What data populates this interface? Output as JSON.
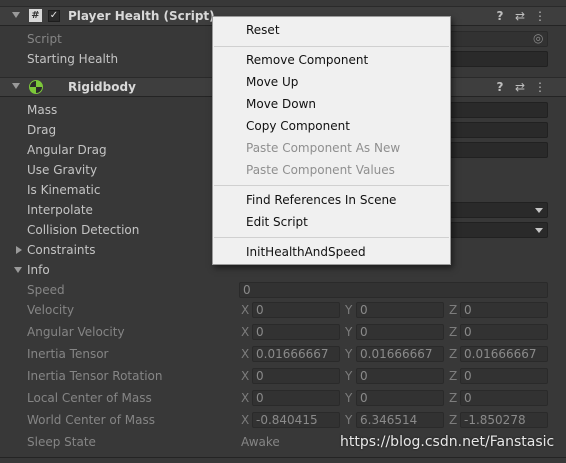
{
  "script_component": {
    "title": "Player Health (Script)",
    "script_label": "Script",
    "starting_health_label": "Starting Health"
  },
  "rigidbody": {
    "title": "Rigidbody",
    "mass_label": "Mass",
    "drag_label": "Drag",
    "angular_drag_label": "Angular Drag",
    "use_gravity_label": "Use Gravity",
    "is_kinematic_label": "Is Kinematic",
    "interpolate_label": "Interpolate",
    "collision_detection_label": "Collision Detection",
    "constraints_label": "Constraints",
    "info_label": "Info",
    "info": {
      "speed_label": "Speed",
      "speed_value": "0",
      "velocity_label": "Velocity",
      "velocity": {
        "x": "0",
        "y": "0",
        "z": "0"
      },
      "angular_velocity_label": "Angular Velocity",
      "angular_velocity": {
        "x": "0",
        "y": "0",
        "z": "0"
      },
      "inertia_tensor_label": "Inertia Tensor",
      "inertia_tensor": {
        "x": "0.01666667",
        "y": "0.01666667",
        "z": "0.01666667"
      },
      "inertia_tensor_rotation_label": "Inertia Tensor Rotation",
      "inertia_tensor_rotation": {
        "x": "0",
        "y": "0",
        "z": "0"
      },
      "local_center_of_mass_label": "Local Center of Mass",
      "local_center_of_mass": {
        "x": "0",
        "y": "0",
        "z": "0"
      },
      "world_center_of_mass_label": "World Center of Mass",
      "world_center_of_mass": {
        "x": "-0.840415",
        "y": "6.346514",
        "z": "-1.850278"
      },
      "sleep_state_label": "Sleep State",
      "sleep_state_value": "Awake"
    },
    "axis_labels": {
      "x": "X",
      "y": "Y",
      "z": "Z"
    }
  },
  "context_menu": {
    "reset": "Reset",
    "remove_component": "Remove Component",
    "move_up": "Move Up",
    "move_down": "Move Down",
    "copy_component": "Copy Component",
    "paste_component_as_new": "Paste Component As New",
    "paste_component_values": "Paste Component Values",
    "find_references": "Find References In Scene",
    "edit_script": "Edit Script",
    "init_health_and_speed": "InitHealthAndSpeed"
  },
  "icons": {
    "help": "?",
    "presets": "⇄",
    "more": "⋮",
    "script_checkbox": "✓",
    "script_hash": "#",
    "object_picker": "◎"
  },
  "watermark": "https://blog.csdn.net/Fanstasic",
  "colors": {
    "panel_bg": "#383838",
    "menu_bg": "#f0f0f0",
    "field_bg": "#2a2a2a"
  }
}
